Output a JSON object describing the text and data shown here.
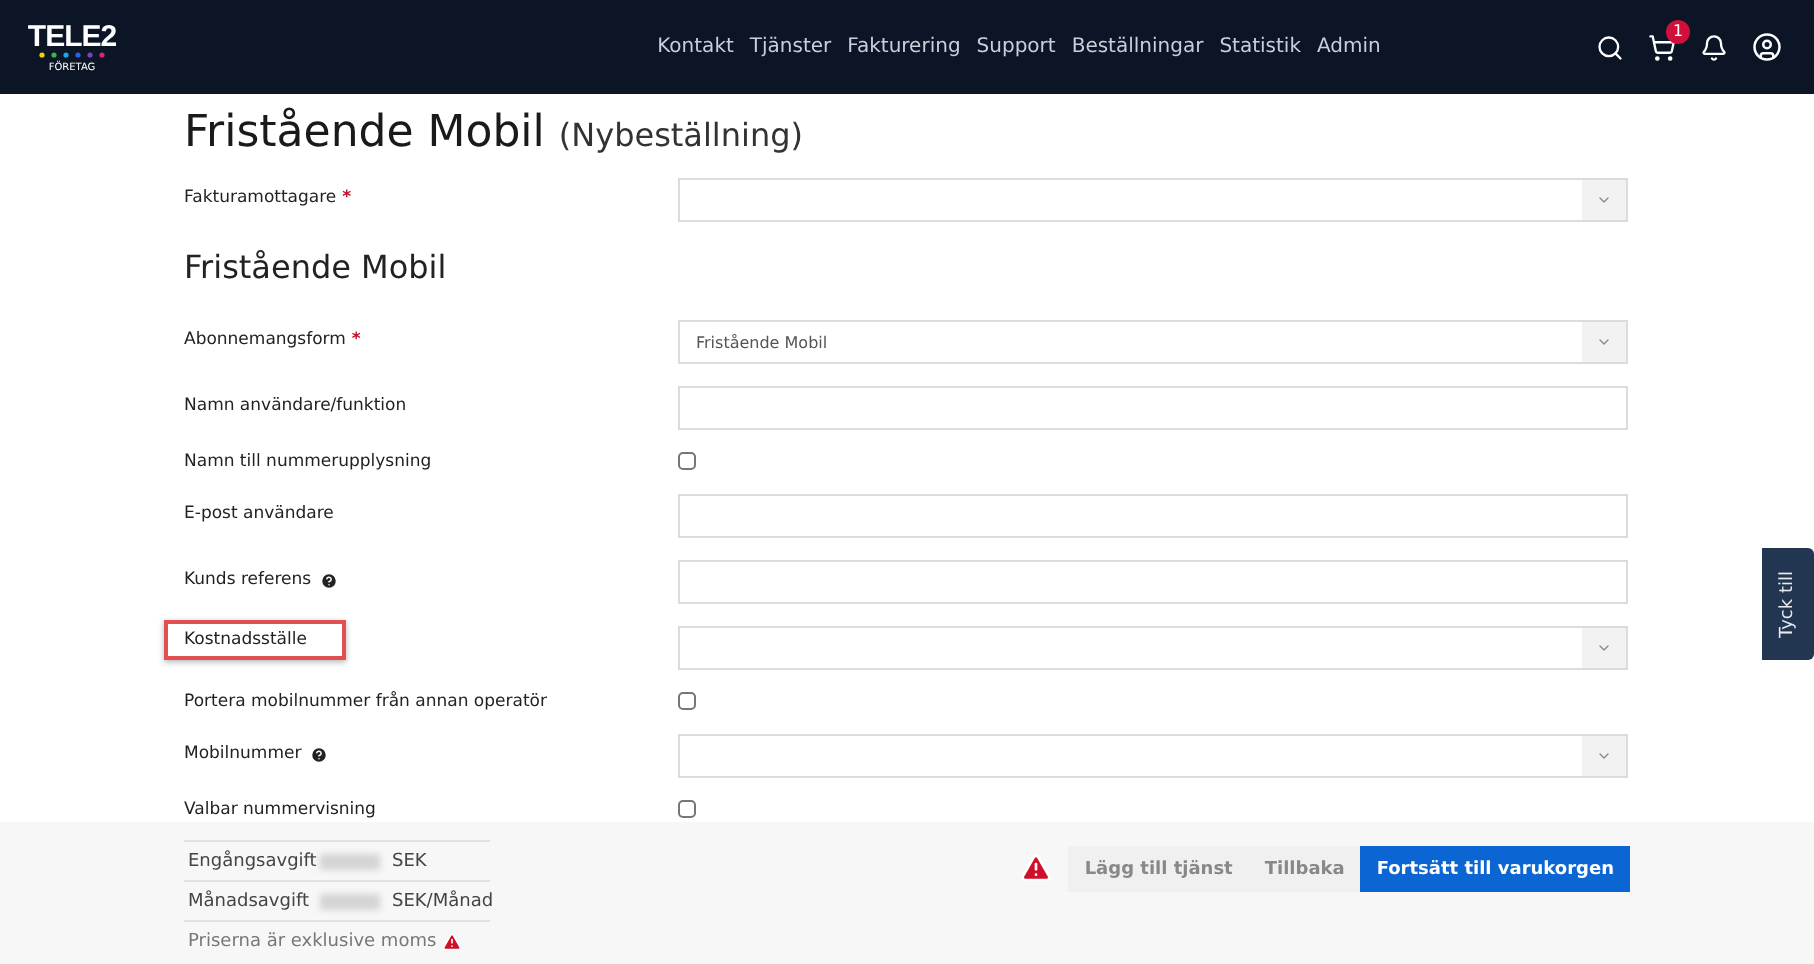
{
  "header": {
    "logo": {
      "name": "TELE2",
      "sub": "FÖRETAG"
    },
    "nav": [
      "Kontakt",
      "Tjänster",
      "Fakturering",
      "Support",
      "Beställningar",
      "Statistik",
      "Admin"
    ],
    "cart_count": "1"
  },
  "page": {
    "title": "Fristående Mobil",
    "subtitle": "(Nybeställning)"
  },
  "top_fields": [
    {
      "kind": "select",
      "label": "Fakturamottagare",
      "required_mark": "*",
      "help": false,
      "highlighted": false
    }
  ],
  "section": {
    "title": "Fristående Mobil"
  },
  "fields": [
    {
      "kind": "select",
      "label": "Abonnemangsform",
      "required_mark": "*",
      "help": false,
      "highlighted": false,
      "value": "Fristående Mobil"
    },
    {
      "kind": "text",
      "label": "Namn användare/funktion",
      "help": false,
      "highlighted": false
    },
    {
      "kind": "checkbox",
      "label": "Namn till nummerupplysning",
      "help": false,
      "highlighted": false,
      "checked": false
    },
    {
      "kind": "text",
      "label": "E-post användare",
      "help": false,
      "highlighted": false
    },
    {
      "kind": "text",
      "label": "Kunds referens",
      "help": true,
      "highlighted": false
    },
    {
      "kind": "select",
      "label": "Kostnadsställe",
      "help": false,
      "highlighted": true
    },
    {
      "kind": "checkbox",
      "label": "Portera mobilnummer från annan operatör",
      "help": false,
      "highlighted": false,
      "checked": false
    },
    {
      "kind": "select",
      "label": "Mobilnummer",
      "help": true,
      "highlighted": false
    },
    {
      "kind": "checkbox",
      "label": "Valbar nummervisning",
      "help": false,
      "highlighted": false,
      "checked": false
    }
  ],
  "footer": {
    "fees": [
      {
        "label": "Engångsavgift",
        "unit": "SEK"
      },
      {
        "label": "Månadsavgift",
        "unit": "SEK/Månad"
      }
    ],
    "note": "Priserna är exklusive moms",
    "buttons": [
      {
        "label": "Lägg till tjänst",
        "primary": false
      },
      {
        "label": "Tillbaka",
        "primary": false
      },
      {
        "label": "Fortsätt till varukorgen",
        "primary": true
      }
    ]
  },
  "feedback_tab": "Tyck till"
}
